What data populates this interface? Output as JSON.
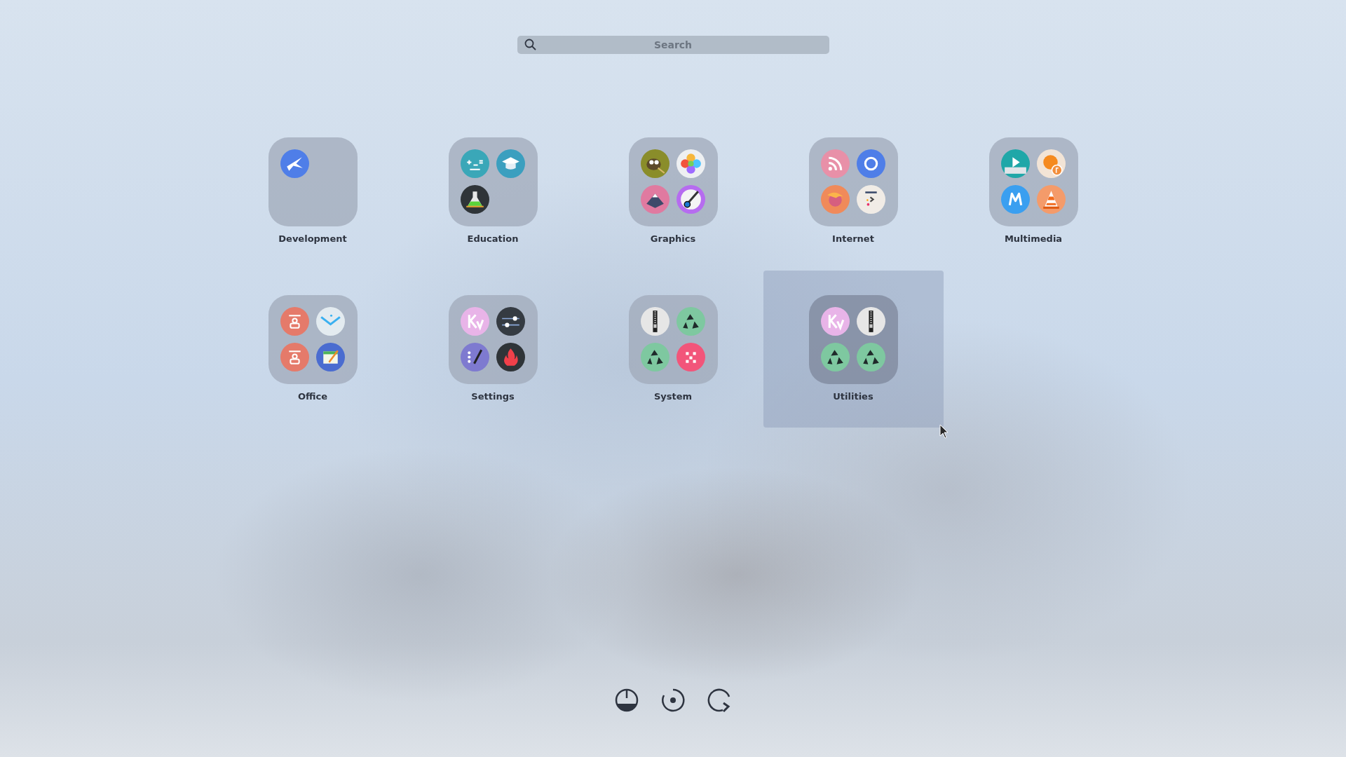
{
  "search": {
    "placeholder": "Search"
  },
  "folders": [
    {
      "label": "Development",
      "selected": false,
      "apps": [
        {
          "kind": "bird"
        }
      ]
    },
    {
      "label": "Education",
      "selected": false,
      "apps": [
        {
          "kind": "math"
        },
        {
          "kind": "cap"
        },
        {
          "kind": "flask"
        }
      ]
    },
    {
      "label": "Graphics",
      "selected": false,
      "apps": [
        {
          "kind": "gimp"
        },
        {
          "kind": "flower"
        },
        {
          "kind": "vector"
        },
        {
          "kind": "brush"
        }
      ]
    },
    {
      "label": "Internet",
      "selected": false,
      "apps": [
        {
          "kind": "rss"
        },
        {
          "kind": "browser"
        },
        {
          "kind": "fox"
        },
        {
          "kind": "terminal"
        }
      ]
    },
    {
      "label": "Multimedia",
      "selected": false,
      "apps": [
        {
          "kind": "player"
        },
        {
          "kind": "music"
        },
        {
          "kind": "letter"
        },
        {
          "kind": "cone"
        }
      ]
    },
    {
      "label": "Office",
      "selected": false,
      "apps": [
        {
          "kind": "contact"
        },
        {
          "kind": "mail"
        },
        {
          "kind": "contact"
        },
        {
          "kind": "calendar"
        }
      ]
    },
    {
      "label": "Settings",
      "selected": false,
      "apps": [
        {
          "kind": "theme"
        },
        {
          "kind": "sliders"
        },
        {
          "kind": "editor"
        },
        {
          "kind": "flame"
        }
      ]
    },
    {
      "label": "System",
      "selected": false,
      "apps": [
        {
          "kind": "zip"
        },
        {
          "kind": "recycle"
        },
        {
          "kind": "recycle"
        },
        {
          "kind": "blocks"
        }
      ]
    },
    {
      "label": "Utilities",
      "selected": true,
      "apps": [
        {
          "kind": "theme"
        },
        {
          "kind": "zip"
        },
        {
          "kind": "recycle"
        },
        {
          "kind": "recycle"
        }
      ]
    }
  ],
  "session_buttons": [
    {
      "kind": "power"
    },
    {
      "kind": "suspend"
    },
    {
      "kind": "restart"
    }
  ]
}
